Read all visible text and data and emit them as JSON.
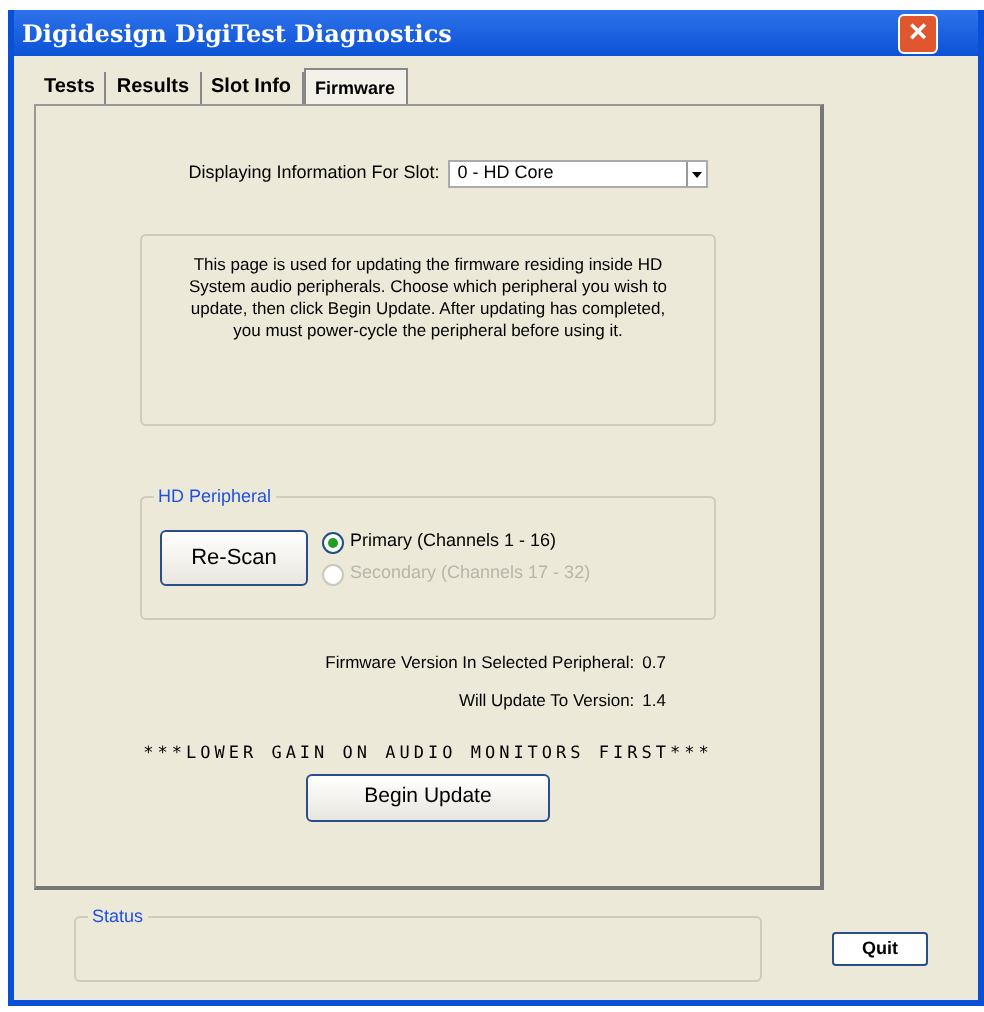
{
  "window": {
    "title": "Digidesign DigiTest Diagnostics",
    "close_button": "×"
  },
  "tabs": [
    {
      "label": "Tests",
      "selected": false
    },
    {
      "label": "Results",
      "selected": false
    },
    {
      "label": "Slot Info",
      "selected": false
    },
    {
      "label": "Firmware",
      "selected": true
    }
  ],
  "slot": {
    "label": "Displaying Information For Slot:",
    "value": "0 - HD Core"
  },
  "info_text": "This page is used for updating the firmware residing inside HD System audio peripherals. Choose which peripheral you wish to update, then click Begin Update. After updating has completed, you must power-cycle the peripheral before using it.",
  "hd_peripheral": {
    "title": "HD Peripheral",
    "rescan_button": "Re-Scan",
    "options": [
      {
        "label": "Primary (Channels 1 - 16)",
        "selected": true,
        "disabled": false
      },
      {
        "label": "Secondary (Channels 17 - 32)",
        "selected": false,
        "disabled": true
      }
    ]
  },
  "versions": [
    {
      "label": "Firmware Version In Selected Peripheral:",
      "value": "0.7"
    },
    {
      "label": "Will Update To Version:",
      "value": "1.4"
    }
  ],
  "warning": "***LOWER GAIN ON AUDIO MONITORS FIRST***",
  "begin_update_button": "Begin Update",
  "status": {
    "title": "Status"
  },
  "quit_button": "Quit"
}
